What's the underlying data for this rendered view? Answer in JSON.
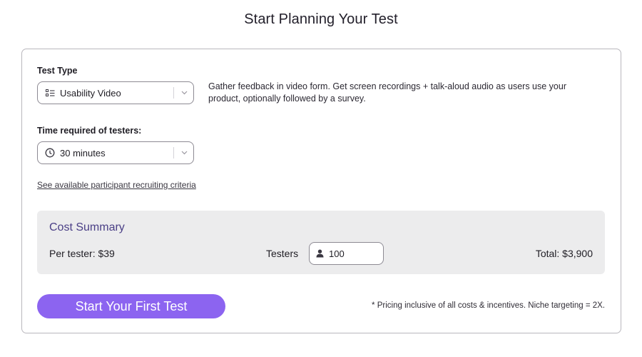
{
  "page": {
    "title": "Start Planning Your Test"
  },
  "test_type": {
    "label": "Test Type",
    "selected": "Usability Video",
    "icon": "list-icon",
    "description": "Gather feedback in video form. Get screen recordings + talk-aloud audio as users use your product, optionally followed by a survey."
  },
  "time_required": {
    "label": "Time required of testers:",
    "selected": "30 minutes",
    "icon": "clock-icon"
  },
  "criteria_link": "See available participant recruiting criteria",
  "cost_summary": {
    "title": "Cost Summary",
    "per_tester": "Per tester:  $39",
    "testers_label": "Testers",
    "testers_value": "100",
    "total": "Total:  $3,900"
  },
  "cta_label": "Start Your First Test",
  "fine_print": "* Pricing inclusive of all costs & incentives. Niche targeting = 2X.",
  "colors": {
    "accent": "#8c64f0",
    "summary_title": "#4a3f86",
    "summary_bg": "#ececed"
  }
}
